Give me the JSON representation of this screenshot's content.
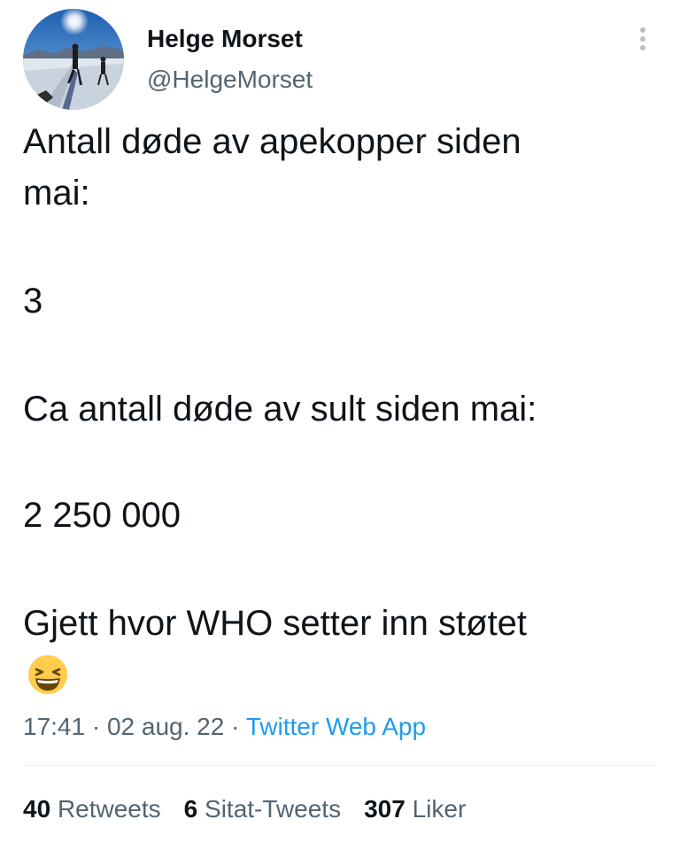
{
  "author": {
    "name": "Helge Morset",
    "handle": "@HelgeMorset",
    "avatar_icon": "profile-photo-ski-landscape"
  },
  "more_icon": "more-dots-vertical-icon",
  "tweet": {
    "lines": [
      "Antall døde av apekopper siden",
      "mai:",
      "3",
      "Ca antall døde av sult siden mai:",
      "2 250 000",
      "Gjett hvor WHO setter inn støtet"
    ],
    "emoji": "grinning-squinting-face-emoji"
  },
  "meta": {
    "time": "17:41",
    "separator": "·",
    "date": "02 aug. 22",
    "source": "Twitter Web App"
  },
  "stats": {
    "retweets": {
      "count": "40",
      "label": "Retweets"
    },
    "quotes": {
      "count": "6",
      "label": "Sitat-Tweets"
    },
    "likes": {
      "count": "307",
      "label": "Liker"
    }
  },
  "colors": {
    "text": "#0f1419",
    "secondary": "#536471",
    "link": "#1d9bf0",
    "divider": "#eff3f4"
  }
}
